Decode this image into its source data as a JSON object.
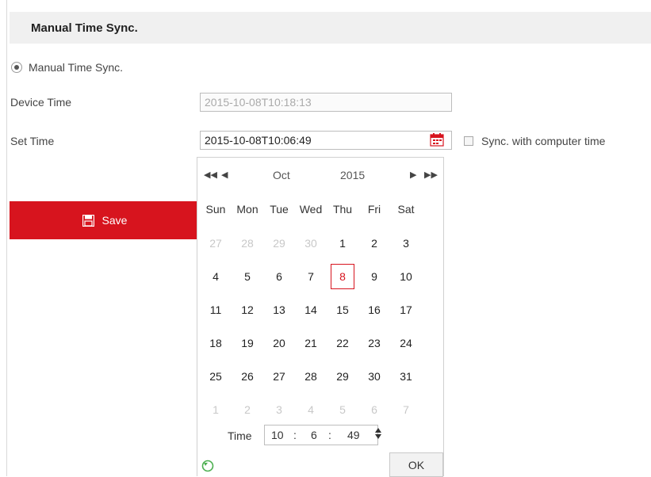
{
  "section": {
    "title": "Manual Time Sync."
  },
  "radio": {
    "label": "Manual Time Sync."
  },
  "device_time": {
    "label": "Device Time",
    "value": "2015-10-08T10:18:13"
  },
  "set_time": {
    "label": "Set Time",
    "value": "2015-10-08T10:06:49"
  },
  "sync": {
    "label": "Sync. with computer time",
    "checked": false
  },
  "save": {
    "label": "Save",
    "color": "#d7141e"
  },
  "calendar": {
    "month": "Oct",
    "year": "2015",
    "nav": {
      "prev_year": "◀◀",
      "prev_month": "◀",
      "next_month": "▶",
      "next_year": "▶▶"
    },
    "weekdays": [
      "Sun",
      "Mon",
      "Tue",
      "Wed",
      "Thu",
      "Fri",
      "Sat"
    ],
    "weeks": [
      [
        "27",
        "28",
        "29",
        "30",
        "1",
        "2",
        "3"
      ],
      [
        "4",
        "5",
        "6",
        "7",
        "8",
        "9",
        "10"
      ],
      [
        "11",
        "12",
        "13",
        "14",
        "15",
        "16",
        "17"
      ],
      [
        "18",
        "19",
        "20",
        "21",
        "22",
        "23",
        "24"
      ],
      [
        "25",
        "26",
        "27",
        "28",
        "29",
        "30",
        "31"
      ],
      [
        "1",
        "2",
        "3",
        "4",
        "5",
        "6",
        "7"
      ]
    ],
    "selected_day": "8",
    "time_label": "Time",
    "hour": "10",
    "minute": "6",
    "second": "49",
    "sep1": ":",
    "sep2": ":",
    "ok_label": "OK"
  }
}
